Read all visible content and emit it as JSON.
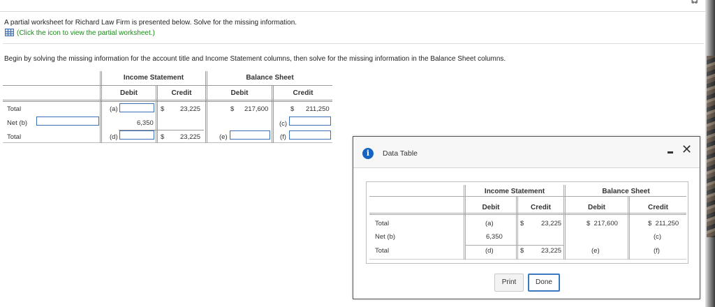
{
  "question": {
    "intro": "A partial worksheet for Richard Law Firm is presented below. Solve for the missing information.",
    "link_text": "(Click the icon to view the partial worksheet.)",
    "instruction": "Begin by solving the missing information for the account title and Income Statement columns, then solve for the missing information in the Balance Sheet columns."
  },
  "worksheet": {
    "group_headers": [
      "Income Statement",
      "Balance Sheet"
    ],
    "col_headers": [
      "Debit",
      "Credit",
      "Debit",
      "Credit"
    ],
    "rows": [
      {
        "label": "Total",
        "is_debit_letter": "(a)",
        "is_credit_dollar": "$",
        "is_credit": "23,225",
        "bs_debit_dollar": "$",
        "bs_debit": "217,600",
        "bs_credit_dollar": "$",
        "bs_credit": "211,250"
      },
      {
        "label": "Net (b)",
        "is_debit": "6,350",
        "bs_credit_letter": "(c)"
      },
      {
        "label": "Total",
        "is_debit_letter": "(d)",
        "is_credit_dollar": "$",
        "is_credit": "23,225",
        "bs_debit_letter": "(e)",
        "bs_credit_letter": "(f)"
      }
    ]
  },
  "modal": {
    "title": "Data Table",
    "group_headers": [
      "Income Statement",
      "Balance Sheet"
    ],
    "col_headers": [
      "Debit",
      "Credit",
      "Debit",
      "Credit"
    ],
    "rows": [
      {
        "label": "Total",
        "is_debit": "(a)",
        "is_credit_dollar": "$",
        "is_credit": "23,225",
        "bs_debit": "$  217,600",
        "bs_credit": "$  211,250"
      },
      {
        "label": "Net (b)",
        "is_debit": "6,350",
        "bs_credit": "(c)"
      },
      {
        "label": "Total",
        "is_debit": "(d)",
        "is_credit_dollar": "$",
        "is_credit": "23,225",
        "bs_debit": "(e)",
        "bs_credit": "(f)"
      }
    ],
    "print_label": "Print",
    "done_label": "Done",
    "info_glyph": "i",
    "close_glyph": "✕"
  },
  "icons": {
    "settings": "gear-icon",
    "worksheet": "table-icon",
    "info": "info-icon",
    "minimize": "minimize-icon",
    "close": "close-icon"
  },
  "colors": {
    "link": "#1a8a1a",
    "input_border": "#3a6fb5",
    "info": "#1565c0",
    "done_border": "#3a78c2"
  }
}
